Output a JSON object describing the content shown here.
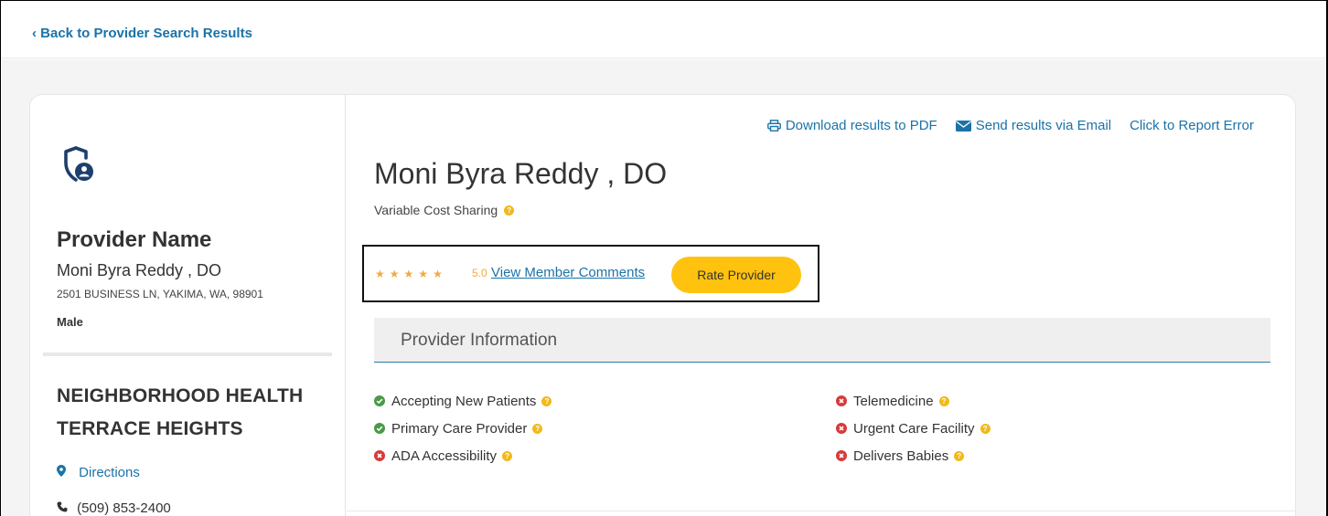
{
  "nav": {
    "back_label": "‹ Back to Provider Search Results"
  },
  "sidebar": {
    "icon": "shield-user-icon",
    "heading": "Provider Name",
    "name": "Moni Byra Reddy , DO",
    "address": "2501 BUSINESS LN, YAKIMA, WA, 98901",
    "gender": "Male",
    "clinic_name": "NEIGHBORHOOD HEALTH TERRACE HEIGHTS",
    "directions_label": "Directions",
    "phone": "(509) 853-2400"
  },
  "actions": {
    "download_label": "Download results to PDF",
    "email_label": "Send results via Email",
    "report_label": "Click to Report Error"
  },
  "provider": {
    "name": "Moni Byra Reddy , DO",
    "cost_sharing": "Variable Cost Sharing"
  },
  "rating": {
    "stars": 5,
    "max_stars": 5,
    "value": "5.0",
    "comments_label": "View Member Comments",
    "rate_button": "Rate Provider"
  },
  "info": {
    "title": "Provider Information",
    "left_column": [
      {
        "label": "Accepting New Patients",
        "status": "yes"
      },
      {
        "label": "Primary Care Provider",
        "status": "yes"
      },
      {
        "label": "ADA Accessibility",
        "status": "no"
      }
    ],
    "right_column": [
      {
        "label": "Telemedicine",
        "status": "no"
      },
      {
        "label": "Urgent Care Facility",
        "status": "no"
      },
      {
        "label": "Delivers Babies",
        "status": "no"
      }
    ]
  },
  "colors": {
    "link": "#1a73a8",
    "accent_button": "#ffc20e",
    "star": "#f3a93c",
    "yes": "#4a9a46",
    "no": "#d73a3a"
  }
}
